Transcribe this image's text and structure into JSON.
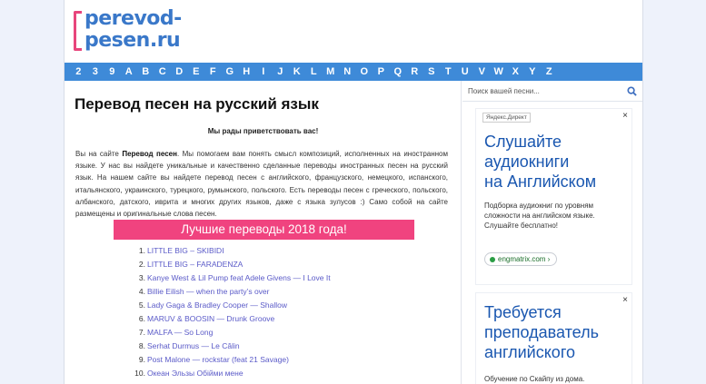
{
  "logo": {
    "line1": "perevod-",
    "line2": "pesen.ru"
  },
  "alphabet": [
    "2",
    "3",
    "9",
    "A",
    "B",
    "C",
    "D",
    "E",
    "F",
    "G",
    "H",
    "I",
    "J",
    "K",
    "L",
    "M",
    "N",
    "O",
    "P",
    "Q",
    "R",
    "S",
    "T",
    "U",
    "V",
    "W",
    "X",
    "Y",
    "Z"
  ],
  "main": {
    "title": "Перевод песен на русский язык",
    "welcome": "Мы рады приветствовать вас!",
    "intro_prefix": "Вы на сайте ",
    "intro_bold": "Перевод песен",
    "intro_rest": ". Мы помогаем вам понять смысл композиций, исполненных на иностранном языке. У нас вы найдете уникальные и качественно сделанные переводы иностранных песен на русский язык. На нашем сайте вы найдете перевод песен с английского, французского, немецкого, испанского, итальянского, украинского, турецкого, румынского, польского. Есть переводы песен с греческого, польского, албанского, датского, иврита и многих других языков, даже с языка зулусов :) Само собой на сайте размещены и оригинальные слова песен.",
    "banner": "Лучшие переводы 2018 года!",
    "top_list": [
      {
        "num": "1.",
        "text": "LITTLE BIG – SKIBIDI"
      },
      {
        "num": "2.",
        "text": "LITTLE BIG – FARADENZA"
      },
      {
        "num": "3.",
        "text": "Kanye West & Lil Pump feat Adele Givens — I Love It"
      },
      {
        "num": "4.",
        "text": "Billie Eilish — when the party’s over"
      },
      {
        "num": "5.",
        "text": "Lady Gaga & Bradley Cooper — Shallow"
      },
      {
        "num": "6.",
        "text": "MARUV & BOOSIN — Drunk Groove"
      },
      {
        "num": "7.",
        "text": "MALFA — So Long"
      },
      {
        "num": "8.",
        "text": "Serhat Durmus — Le Câlin"
      },
      {
        "num": "9.",
        "text": "Post Malone — rockstar (feat 21 Savage)"
      },
      {
        "num": "10.",
        "text": "Океан Эльзы Обійми мене"
      }
    ]
  },
  "sidebar": {
    "search_placeholder": "Поиск вашей песни...",
    "ad1": {
      "label": "Яндекс.Директ",
      "close": "×",
      "title_lines": [
        "Слушайте",
        "аудиокниги",
        "на Английском"
      ],
      "desc": "Подборка аудиокниг по уровням сложности на английском языке. Слушайте бесплатно!",
      "link": "engmatrix.com ›"
    },
    "ad2": {
      "close": "×",
      "title_lines": [
        "Требуется",
        "преподаватель",
        "английского"
      ],
      "desc": "Обучение по Скайпу из дома."
    }
  },
  "colors": {
    "nav_bar": "#3e8ad8",
    "banner": "#f0437f",
    "link": "#5a5ac8",
    "ad_title": "#1a57b0"
  }
}
